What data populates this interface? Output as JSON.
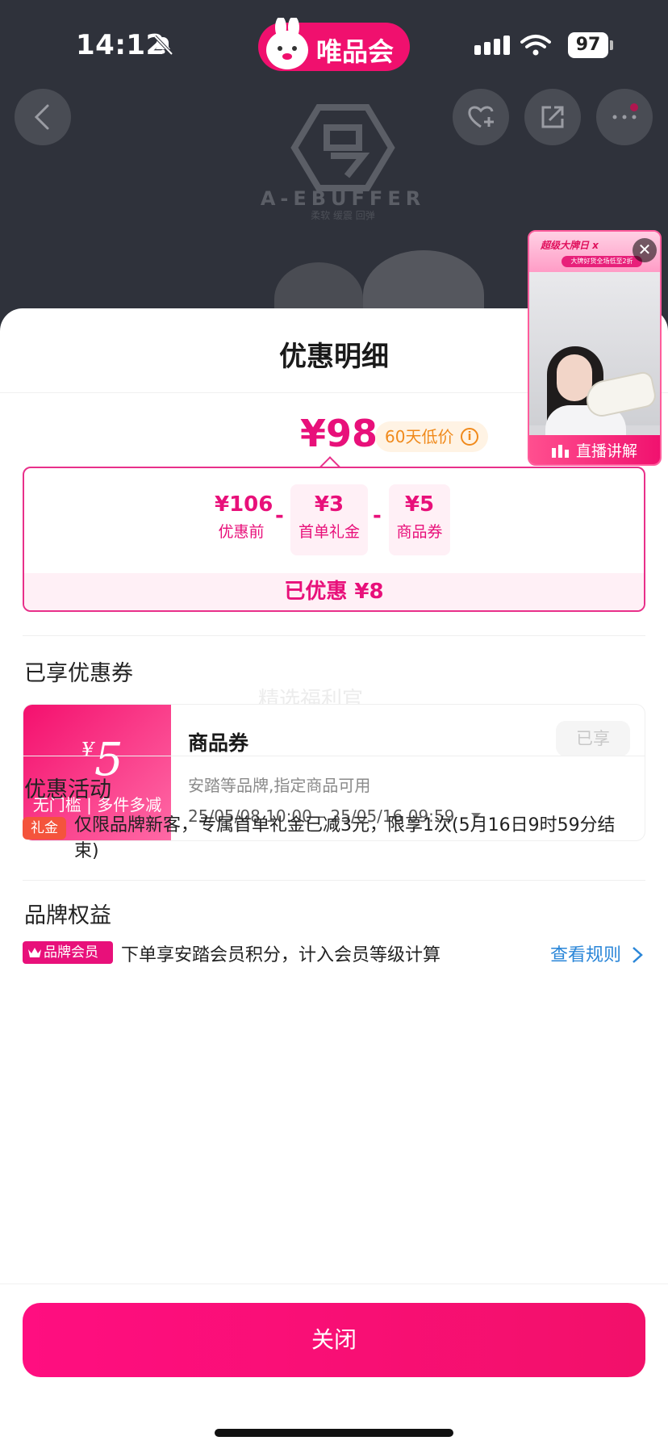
{
  "status_bar": {
    "time": "14:12",
    "battery": "97",
    "icons": [
      "bell-muted-icon",
      "signal-icon",
      "wifi-icon",
      "battery-icon"
    ]
  },
  "app": {
    "brand_name": "唯品会",
    "brand_color": "#f0106e"
  },
  "background": {
    "logo_text": "A-EBUFFER",
    "logo_sub": "柔软 缓震 回弹",
    "icons": [
      "back-icon",
      "favorite-add-icon",
      "share-icon",
      "more-icon"
    ]
  },
  "live": {
    "banner_title": "超级大牌日 x",
    "banner_sub": "大牌好货全场低至2折",
    "label": "直播讲解",
    "accent": "#f0106e"
  },
  "sheet": {
    "title": "优惠明细",
    "final_price": "¥98",
    "low_price_badge": "60天低价",
    "info_glyph": "i",
    "breakdown": {
      "original": {
        "amount": "¥106",
        "label": "优惠前"
      },
      "items": [
        {
          "amount": "¥3",
          "label": "首单礼金"
        },
        {
          "amount": "¥5",
          "label": "商品券"
        }
      ],
      "operator": "-",
      "saved": "已优惠 ¥8"
    },
    "coupons_section": {
      "title": "已享优惠券",
      "watermark": "精选福利官",
      "coupon": {
        "currency": "¥",
        "value": "5",
        "condition": "无门槛 | 多件多减",
        "name": "商品券",
        "description": "安踏等品牌,指定商品可用",
        "validity": "25/05/08 10:00 – 25/05/16 09:59",
        "status": "已享"
      }
    },
    "activity_section": {
      "title": "优惠活动",
      "tag": "礼金",
      "text": "仅限品牌新客，专属首单礼金已减3元，限享1次(5月16日9时59分结束)"
    },
    "brand_section": {
      "title": "品牌权益",
      "tag": "品牌会员",
      "text": "下单享安踏会员积分，计入会员等级计算",
      "link": "查看规则"
    },
    "close_label": "关闭"
  },
  "colors": {
    "accent": "#e8107a",
    "link": "#2a86d8",
    "gift": "#f4543c"
  }
}
